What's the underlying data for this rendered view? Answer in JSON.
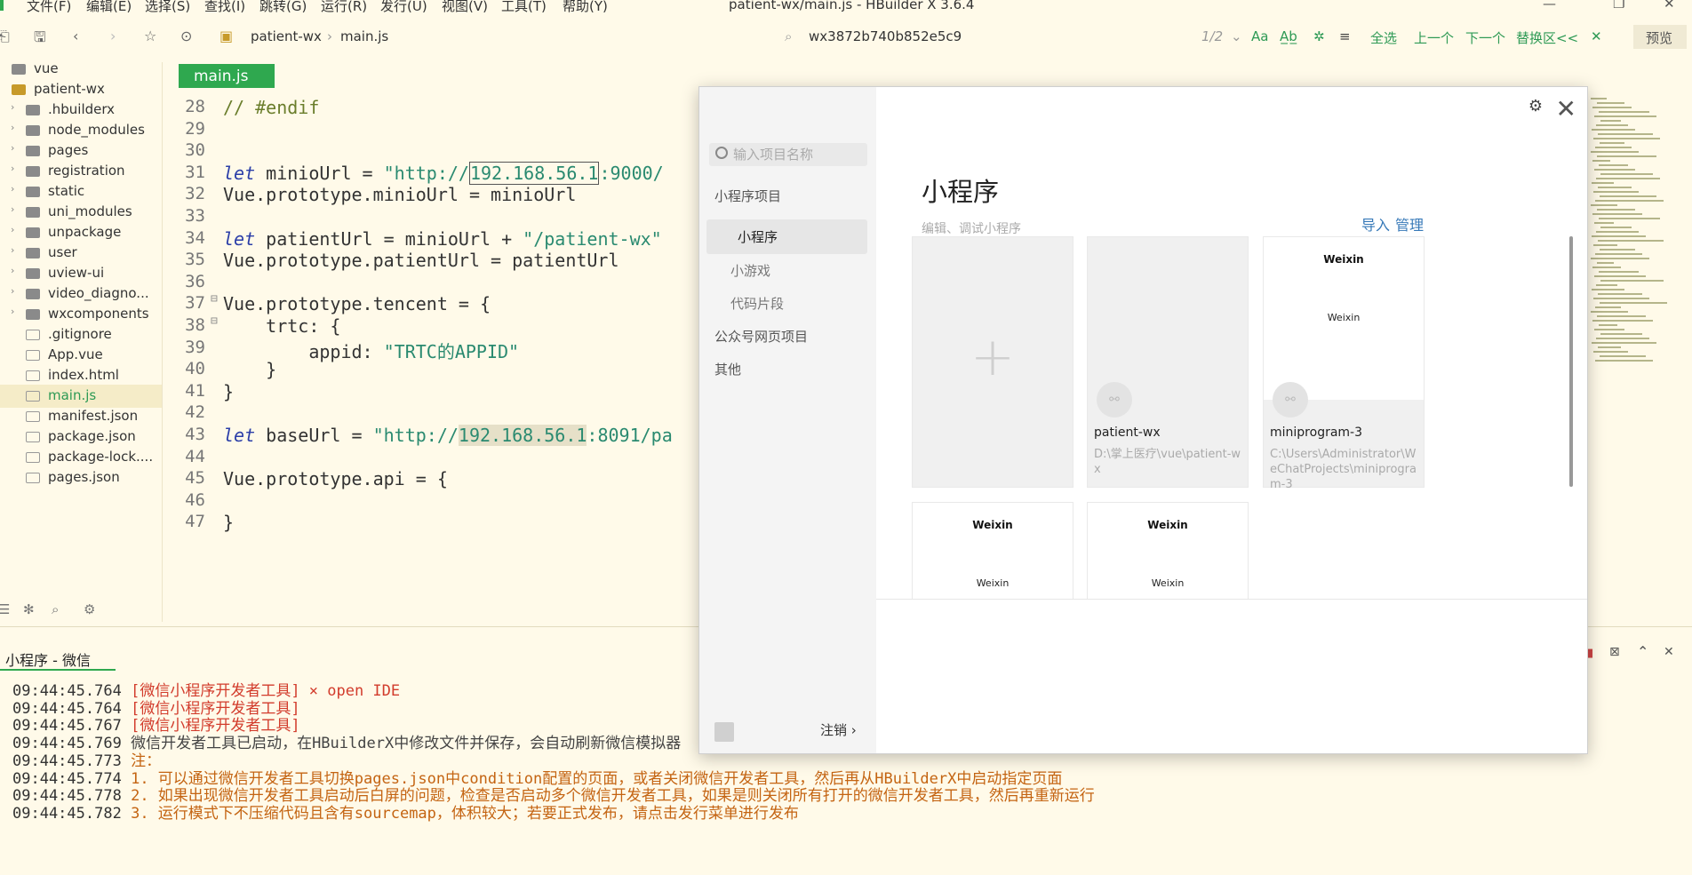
{
  "window": {
    "title": "patient-wx/main.js - HBuilder X 3.6.4",
    "menu": [
      "文件(F)",
      "编辑(E)",
      "选择(S)",
      "查找(I)",
      "跳转(G)",
      "运行(R)",
      "发行(U)",
      "视图(V)",
      "工具(T)",
      "帮助(Y)"
    ]
  },
  "toolbar": {
    "breadcrumb": [
      "patient-wx",
      "main.js"
    ],
    "find_value": "wx3872b740b852e5c9",
    "find_count": "1/2",
    "find_actions": [
      "全选",
      "上一个",
      "下一个",
      "替换区<<"
    ],
    "preview": "预览"
  },
  "sidebar": {
    "items": [
      {
        "label": "vue",
        "type": "folder",
        "arrow": "",
        "indent": 0
      },
      {
        "label": "patient-wx",
        "type": "project",
        "arrow": "",
        "indent": 0
      },
      {
        "label": ".hbuilderx",
        "type": "folder",
        "arrow": "›",
        "indent": 1
      },
      {
        "label": "node_modules",
        "type": "folder",
        "arrow": "›",
        "indent": 1
      },
      {
        "label": "pages",
        "type": "folder",
        "arrow": "›",
        "indent": 1
      },
      {
        "label": "registration",
        "type": "folder",
        "arrow": "›",
        "indent": 1
      },
      {
        "label": "static",
        "type": "folder",
        "arrow": "›",
        "indent": 1
      },
      {
        "label": "uni_modules",
        "type": "folder",
        "arrow": "›",
        "indent": 1
      },
      {
        "label": "unpackage",
        "type": "folder",
        "arrow": "›",
        "indent": 1
      },
      {
        "label": "user",
        "type": "folder",
        "arrow": "›",
        "indent": 1
      },
      {
        "label": "uview-ui",
        "type": "folder",
        "arrow": "›",
        "indent": 1
      },
      {
        "label": "video_diagno...",
        "type": "folder",
        "arrow": "›",
        "indent": 1
      },
      {
        "label": "wxcomponents",
        "type": "folder",
        "arrow": "›",
        "indent": 1
      },
      {
        "label": ".gitignore",
        "type": "file",
        "arrow": "",
        "indent": 1
      },
      {
        "label": "App.vue",
        "type": "file",
        "arrow": "",
        "indent": 1
      },
      {
        "label": "index.html",
        "type": "file",
        "arrow": "",
        "indent": 1
      },
      {
        "label": "main.js",
        "type": "file",
        "arrow": "",
        "indent": 1,
        "selected": true
      },
      {
        "label": "manifest.json",
        "type": "file",
        "arrow": "",
        "indent": 1
      },
      {
        "label": "package.json",
        "type": "file",
        "arrow": "",
        "indent": 1
      },
      {
        "label": "package-lock....",
        "type": "file",
        "arrow": "",
        "indent": 1
      },
      {
        "label": "pages.json",
        "type": "file",
        "arrow": "",
        "indent": 1
      }
    ]
  },
  "editor": {
    "tab": "main.js",
    "lines": [
      {
        "n": "28",
        "fold": "",
        "segs": [
          {
            "t": "// #endif",
            "c": "cm"
          }
        ]
      },
      {
        "n": "29",
        "fold": "",
        "segs": []
      },
      {
        "n": "30",
        "fold": "",
        "segs": []
      },
      {
        "n": "31",
        "fold": "",
        "segs": [
          {
            "t": "let",
            "c": "kw"
          },
          {
            "t": " minioUrl = ",
            "c": ""
          },
          {
            "t": "\"http://",
            "c": "str"
          },
          {
            "t": "192.168.56.1",
            "c": "str hlbox"
          },
          {
            "t": ":9000/",
            "c": "str"
          }
        ]
      },
      {
        "n": "32",
        "fold": "",
        "segs": [
          {
            "t": "Vue.prototype.minioUrl = minioUrl",
            "c": ""
          }
        ]
      },
      {
        "n": "33",
        "fold": "",
        "segs": []
      },
      {
        "n": "34",
        "fold": "",
        "segs": [
          {
            "t": "let",
            "c": "kw"
          },
          {
            "t": " patientUrl = minioUrl + ",
            "c": ""
          },
          {
            "t": "\"/patient-wx\"",
            "c": "str"
          }
        ]
      },
      {
        "n": "35",
        "fold": "",
        "segs": [
          {
            "t": "Vue.prototype.patientUrl = patientUrl",
            "c": ""
          }
        ]
      },
      {
        "n": "36",
        "fold": "",
        "segs": []
      },
      {
        "n": "37",
        "fold": "⊟",
        "segs": [
          {
            "t": "Vue.prototype.tencent = {",
            "c": ""
          }
        ]
      },
      {
        "n": "38",
        "fold": "⊟",
        "segs": [
          {
            "t": "    trtc: {",
            "c": ""
          }
        ]
      },
      {
        "n": "39",
        "fold": "",
        "segs": [
          {
            "t": "        appid: ",
            "c": ""
          },
          {
            "t": "\"TRTC的APPID\"",
            "c": "str"
          }
        ]
      },
      {
        "n": "40",
        "fold": "",
        "segs": [
          {
            "t": "    }",
            "c": ""
          }
        ]
      },
      {
        "n": "41",
        "fold": "",
        "segs": [
          {
            "t": "}",
            "c": ""
          }
        ]
      },
      {
        "n": "42",
        "fold": "",
        "segs": []
      },
      {
        "n": "43",
        "fold": "",
        "segs": [
          {
            "t": "let",
            "c": "kw"
          },
          {
            "t": " baseUrl = ",
            "c": ""
          },
          {
            "t": "\"http://",
            "c": "str"
          },
          {
            "t": "192.168.56.1",
            "c": "str hl"
          },
          {
            "t": ":8091/pa",
            "c": "str"
          }
        ]
      },
      {
        "n": "44",
        "fold": "",
        "segs": []
      },
      {
        "n": "45",
        "fold": "",
        "segs": [
          {
            "t": "Vue.prototype.api = {",
            "c": ""
          }
        ]
      },
      {
        "n": "46",
        "fold": "",
        "segs": []
      },
      {
        "n": "47",
        "fold": "",
        "segs": [
          {
            "t": "}",
            "c": ""
          }
        ]
      }
    ]
  },
  "console": {
    "tab": "小程序 - 微信",
    "lines": [
      {
        "time": "09:44:45.764",
        "text": "[微信小程序开发者工具] × open IDE",
        "color": "cred"
      },
      {
        "time": "09:44:45.764",
        "text": "[微信小程序开发者工具]",
        "color": "cred"
      },
      {
        "time": "09:44:45.767",
        "text": "[微信小程序开发者工具]",
        "color": "cred"
      },
      {
        "time": "09:44:45.769",
        "text": "微信开发者工具已启动，在HBuilderX中修改文件并保存，会自动刷新微信模拟器",
        "color": "cgray"
      },
      {
        "time": "09:44:45.773",
        "text": "注：",
        "color": "corange"
      },
      {
        "time": "09:44:45.774",
        "text": "1. 可以通过微信开发者工具切换pages.json中condition配置的页面，或者关闭微信开发者工具，然后再从HBuilderX中启动指定页面",
        "color": "corange"
      },
      {
        "time": "09:44:45.778",
        "text": "2. 如果出现微信开发者工具启动后白屏的问题，检查是否启动多个微信开发者工具，如果是则关闭所有打开的微信开发者工具，然后再重新运行",
        "color": "corange"
      },
      {
        "time": "09:44:45.782",
        "text": "3. 运行模式下不压缩代码且含有sourcemap，体积较大；若要正式发布，请点击发行菜单进行发布",
        "color": "corange"
      }
    ]
  },
  "dialog": {
    "search_placeholder": "输入项目名称",
    "nav": [
      "小程序项目",
      "小程序",
      "小游戏",
      "代码片段",
      "公众号网页项目",
      "其他"
    ],
    "title": "小程序",
    "subtitle": "编辑、调试小程序",
    "import": "导入",
    "manage": "管理",
    "logout": "注销 ›",
    "cards": [
      {
        "name": "patient-wx",
        "path": "D:\\掌上医疗\\vue\\patient-wx"
      },
      {
        "name": "miniprogram-3",
        "path": "C:\\Users\\Administrator\\WeChatProjects\\miniprogram-3",
        "wx_line1": "Weixin",
        "wx_line2": "Weixin"
      }
    ],
    "bottom_cards": [
      {
        "wx_line1": "Weixin",
        "wx_line2": "Weixin"
      },
      {
        "wx_line1": "Weixin",
        "wx_line2": "Weixin"
      }
    ]
  }
}
